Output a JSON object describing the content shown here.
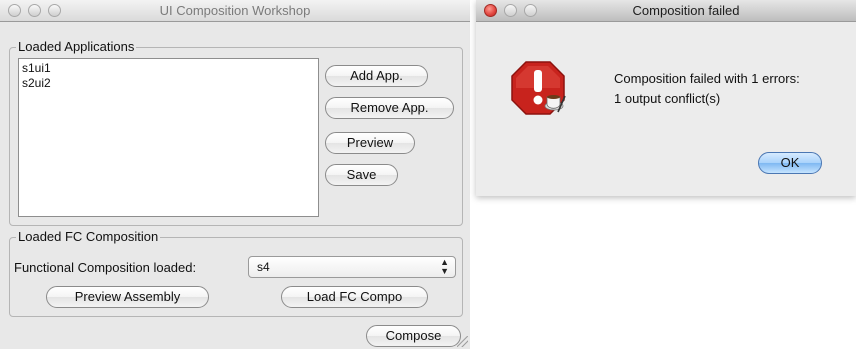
{
  "main_window": {
    "title": "UI Composition Workshop",
    "loaded_applications": {
      "label": "Loaded Applications",
      "items": [
        "s1ui1",
        "s2ui2"
      ],
      "buttons": {
        "add": "Add App.",
        "remove": "Remove App.",
        "preview": "Preview",
        "save": "Save"
      }
    },
    "loaded_fc_composition": {
      "label": "Loaded FC Composition",
      "field_label": "Functional Composition loaded:",
      "selected_value": "s4",
      "buttons": {
        "preview_assembly": "Preview Assembly",
        "load_fc_compo": "Load FC Compo"
      }
    },
    "compose_button": "Compose"
  },
  "dialog": {
    "title": "Composition failed",
    "message_line1": "Composition failed with 1 errors:",
    "message_line2": "1 output conflict(s)",
    "ok_button": "OK",
    "icon": "stop-error-icon"
  },
  "colors": {
    "close_red": "#e0443e",
    "stop_sign_red": "#c8231d",
    "default_button_blue": "#7fb8f2"
  }
}
